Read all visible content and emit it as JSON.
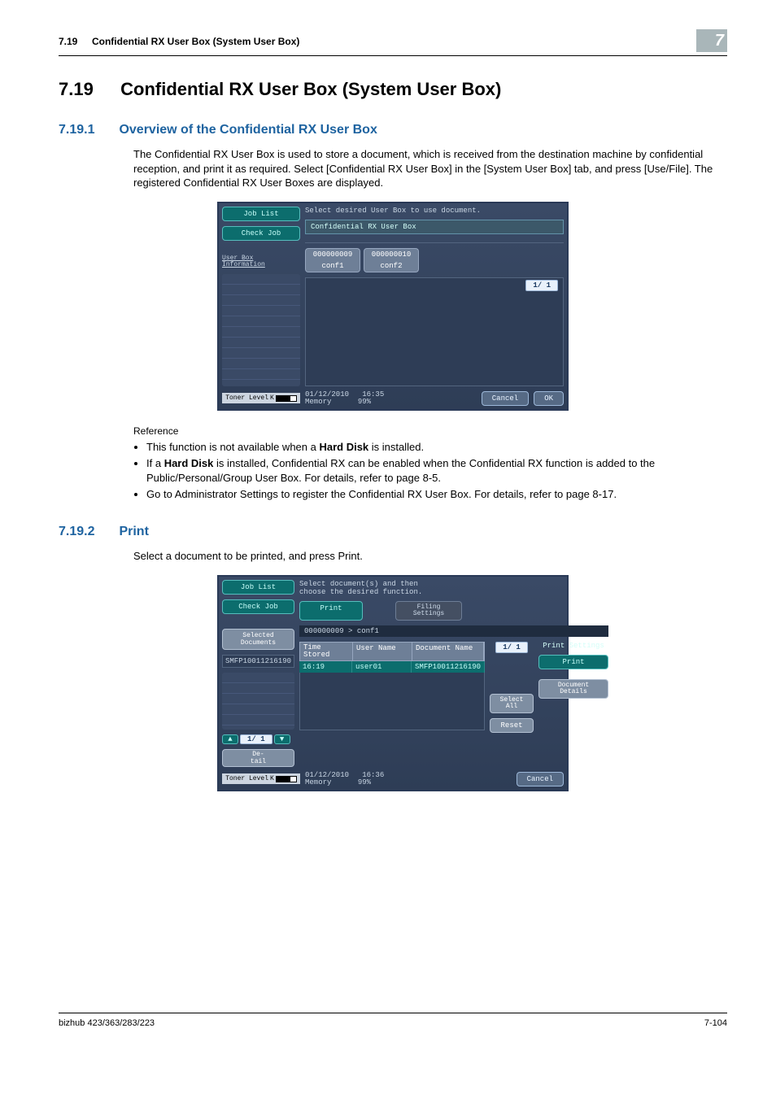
{
  "header": {
    "section_number": "7.19",
    "title": "Confidential RX User Box (System User Box)",
    "chapter": "7"
  },
  "s719": {
    "num": "7.19",
    "title": "Confidential RX User Box (System User Box)"
  },
  "s7191": {
    "num": "7.19.1",
    "title": "Overview of the Confidential RX User Box",
    "para": "The Confidential RX User Box is used to store a document, which is received from the destination machine by confidential reception, and print it as required. Select [Confidential RX User Box] in the [System User Box] tab, and press [Use/File]. The registered Confidential RX User Boxes are displayed.",
    "ref_label": "Reference",
    "bullets": [
      "This function is not available when a Hard Disk is installed.",
      "If a Hard Disk is installed, Confidential RX can be enabled when the Confidential RX function is added to the Public/Personal/Group User Box. For details, refer to page 8-5.",
      "Go to Administrator Settings to register the Confidential RX User Box. For details, refer to page 8-17."
    ],
    "bullet0_strong": "Hard Disk",
    "bullet1_strong": "Hard Disk"
  },
  "s7192": {
    "num": "7.19.2",
    "title": "Print",
    "para": "Select a document to be printed, and press Print."
  },
  "mock1": {
    "prompt": "Select desired User Box to use document.",
    "job_list": "Job List",
    "check_job": "Check Job",
    "userbox_info": "User Box\nInformation",
    "band": "Confidential RX User Box",
    "tabs": [
      {
        "id": "000000009",
        "name": "conf1"
      },
      {
        "id": "000000010",
        "name": "conf2"
      }
    ],
    "page_indicator": "1/   1",
    "toner": "Toner Level",
    "toner_k": "K",
    "date": "01/12/2010",
    "time": "16:35",
    "mem_label": "Memory",
    "mem_value": "99%",
    "cancel": "Cancel",
    "ok": "OK"
  },
  "mock2": {
    "prompt": "Select document(s) and then\nchoose the desired function.",
    "job_list": "Job List",
    "check_job": "Check Job",
    "sel_docs": "Selected Documents",
    "sel_item": "SMFP10011216190",
    "tab_print": "Print",
    "tab_filing": "Filing\nSettings",
    "crumb": "000000009 > conf1",
    "col_time": "Time\nStored",
    "col_user": "User Name",
    "col_doc": "Document Name",
    "row_time": "16:19",
    "row_user": "user01",
    "row_doc": "SMFP10011216190",
    "page_indicator": "1/   1",
    "print_settings": "Print Settings",
    "print_btn": "Print",
    "select_all": "Select\nAll",
    "reset": "Reset",
    "doc_details": "Document\nDetails",
    "detail": "De-\ntail",
    "nav_page": "1/  1",
    "toner": "Toner Level",
    "toner_k": "K",
    "date": "01/12/2010",
    "time": "16:36",
    "mem_label": "Memory",
    "mem_value": "99%",
    "cancel": "Cancel"
  },
  "footer": {
    "model": "bizhub 423/363/283/223",
    "page": "7-104"
  }
}
